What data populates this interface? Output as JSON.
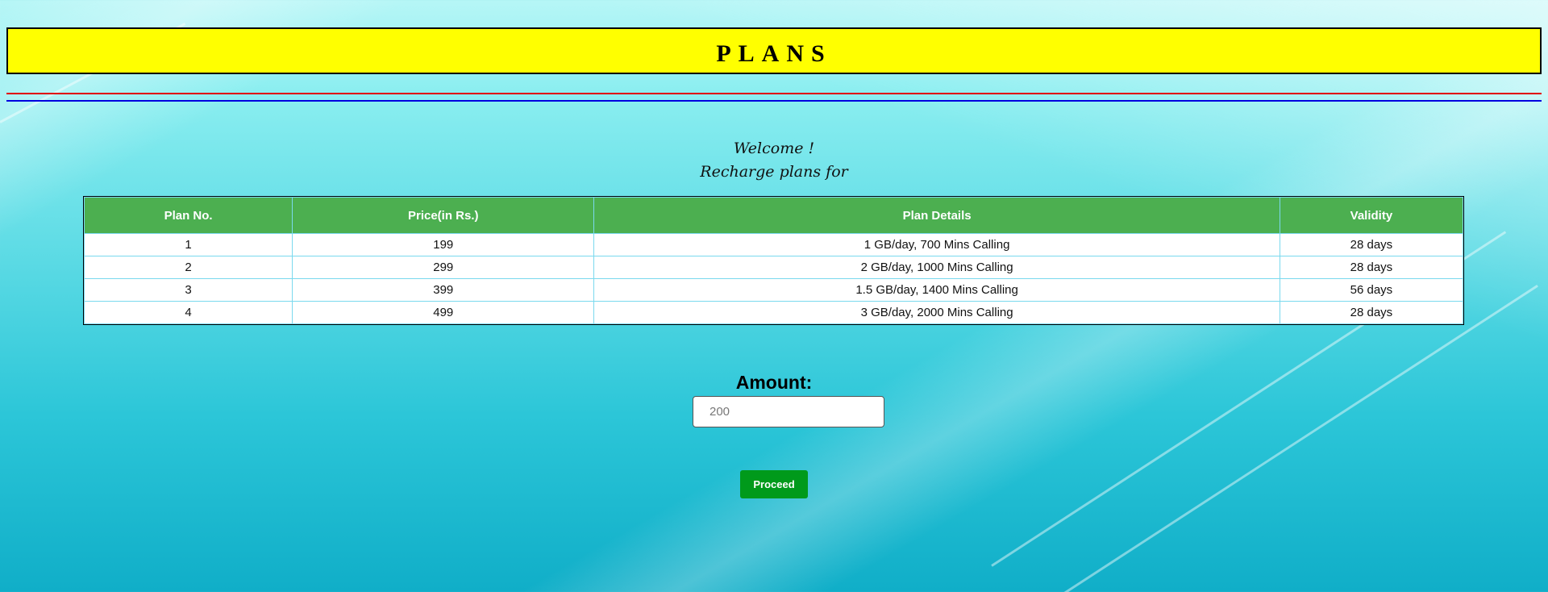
{
  "header": {
    "title": "PLANS"
  },
  "welcome": {
    "line1": "Welcome !",
    "line2": "Recharge plans for"
  },
  "plans_table": {
    "columns": [
      "Plan No.",
      "Price(in Rs.)",
      "Plan Details",
      "Validity"
    ],
    "rows": [
      [
        "1",
        "199",
        "1 GB/day, 700 Mins Calling",
        "28 days"
      ],
      [
        "2",
        "299",
        "2 GB/day, 1000 Mins Calling",
        "28 days"
      ],
      [
        "3",
        "399",
        "1.5 GB/day, 1400 Mins Calling",
        "56 days"
      ],
      [
        "4",
        "499",
        "3 GB/day, 2000 Mins Calling",
        "28 days"
      ]
    ]
  },
  "amount": {
    "label": "Amount:",
    "placeholder": "200",
    "value": ""
  },
  "proceed": {
    "label": "Proceed"
  },
  "colors": {
    "title_bg": "#ffff00",
    "table_header": "#4caf50",
    "button": "#009a1b",
    "rule_top": "#e00000",
    "rule_bottom": "#0000e0"
  }
}
